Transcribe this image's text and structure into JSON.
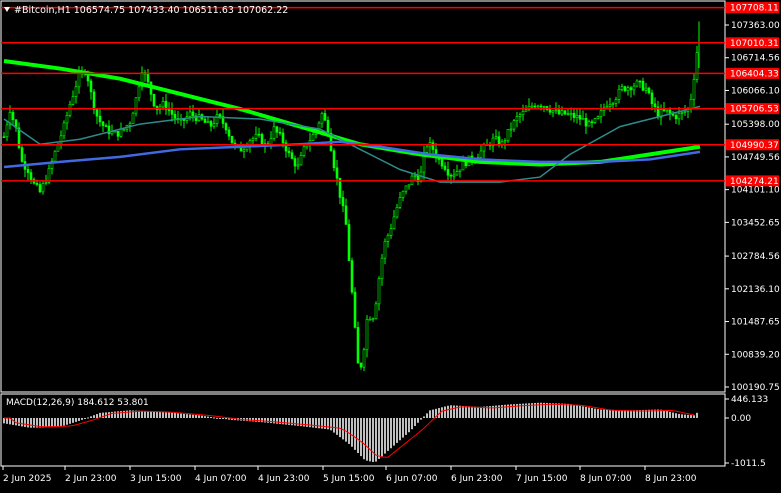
{
  "header": {
    "title": "#Bitcoin,H1  106574.75 107433.40 106511.63 107062.22",
    "menu_icon": "triangle-down-icon"
  },
  "macd": {
    "label": "MACD(12,26,9) 184.612 53.801",
    "axis_labels": [
      "446.133",
      "0.00",
      "-1011.5"
    ]
  },
  "price_axis": {
    "labels": [
      "107363.00",
      "106714.56",
      "106066.10",
      "105398.00",
      "104749.56",
      "104101.10",
      "103452.65",
      "102784.56",
      "102136.10",
      "101487.65",
      "100839.20",
      "100190.75"
    ]
  },
  "levels": [
    {
      "label": "107708.11",
      "value": 107708.11
    },
    {
      "label": "107010.31",
      "value": 107010.31
    },
    {
      "label": "106404.33",
      "value": 106404.33
    },
    {
      "label": "105706.53",
      "value": 105706.53
    },
    {
      "label": "104990.37",
      "value": 104990.37
    },
    {
      "label": "104274.21",
      "value": 104274.21
    }
  ],
  "time_axis": {
    "labels": [
      "2 Jun 2025",
      "2 Jun 23:00",
      "3 Jun 15:00",
      "4 Jun 07:00",
      "4 Jun 23:00",
      "5 Jun 15:00",
      "6 Jun 07:00",
      "6 Jun 23:00",
      "7 Jun 15:00",
      "8 Jun 07:00",
      "8 Jun 23:00"
    ]
  },
  "colors": {
    "background": "#000000",
    "candle": "#00ff00",
    "level_line": "#ff0000",
    "ma_long": "#00ff00",
    "ma_mid": "#2e8b8b",
    "ma_short": "#4169e1",
    "macd_hist": "#c0c0c0",
    "macd_signal": "#ff0000",
    "axis": "#ffffff"
  }
}
